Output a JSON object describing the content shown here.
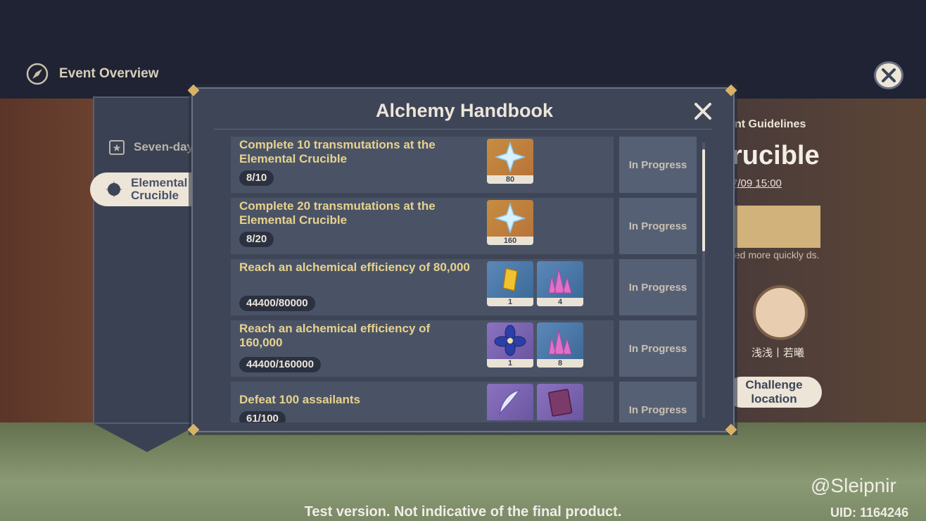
{
  "header": {
    "title": "Event Overview"
  },
  "sidebar": {
    "items": [
      {
        "label": "Seven-day"
      },
      {
        "label": "Elemental Crucible"
      }
    ]
  },
  "right_info": {
    "guide": "nt Guidelines",
    "name_partial": "rucible",
    "date": "7/09 15:00",
    "note": "ted more quickly ds.",
    "character_name": "浅浅丨若曦",
    "challenge_label": "Challenge location"
  },
  "modal": {
    "title": "Alchemy Handbook",
    "tasks": [
      {
        "desc": "Complete 10 transmutations at the Elemental Crucible",
        "progress": "8/10",
        "status": "In Progress",
        "rewards": [
          {
            "icon": "primogem-icon",
            "count": "80"
          }
        ]
      },
      {
        "desc": "Complete 20 transmutations at the Elemental Crucible",
        "progress": "8/20",
        "status": "In Progress",
        "rewards": [
          {
            "icon": "primogem-icon",
            "count": "160"
          }
        ]
      },
      {
        "desc": "Reach an alchemical efficiency of 80,000",
        "progress": "44400/80000",
        "status": "In Progress",
        "rewards": [
          {
            "icon": "gold-shard-icon",
            "count": "1"
          },
          {
            "icon": "pink-crystal-icon",
            "count": "4"
          }
        ]
      },
      {
        "desc": "Reach an alchemical efficiency of 160,000",
        "progress": "44400/160000",
        "status": "In Progress",
        "rewards": [
          {
            "icon": "blue-flower-icon",
            "count": "1"
          },
          {
            "icon": "pink-crystal-icon",
            "count": "8"
          }
        ]
      },
      {
        "desc": "Defeat 100 assailants",
        "progress": "61/100",
        "status": "In Progress",
        "rewards": [
          {
            "icon": "feather-icon",
            "count": ""
          },
          {
            "icon": "book-icon",
            "count": ""
          }
        ]
      }
    ]
  },
  "footer": {
    "note": "Test version. Not indicative of the final product.",
    "watermark": "@Sleipnir",
    "uid": "UID: 1164246"
  },
  "colors": {
    "accent_gold": "#e7d28d",
    "panel": "#3d4557",
    "cream": "#ece5d8"
  }
}
